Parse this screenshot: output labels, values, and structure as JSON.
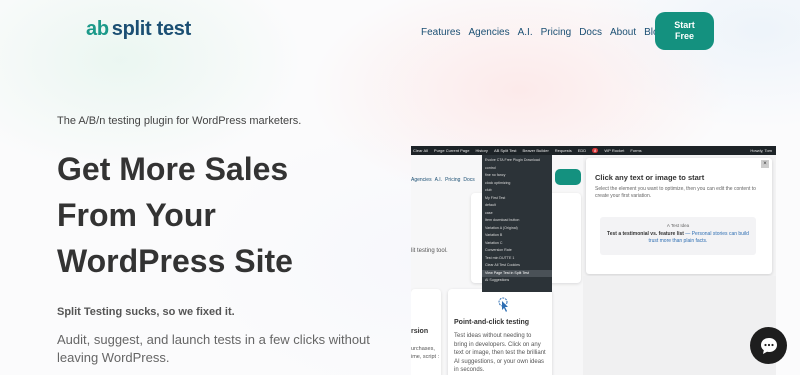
{
  "logo": {
    "ab": "ab",
    "text": "split test"
  },
  "nav": {
    "items": [
      "Features",
      "Agencies",
      "A.I.",
      "Pricing",
      "Docs",
      "About",
      "Blog"
    ]
  },
  "cta": {
    "label": "Start\nFree"
  },
  "hero": {
    "tagline": "The A/B/n testing plugin for WordPress marketers.",
    "headline": [
      "Get More Sales",
      "From Your",
      "WordPress Site"
    ],
    "subhead": "Split Testing sucks, so we fixed it.",
    "description": "Audit, suggest, and launch tests in a few clicks without leaving WordPress."
  },
  "screenshot": {
    "adminbar": [
      "Clear All",
      "Purge Current Page",
      "History",
      "AB Split Test",
      "Beaver Builder",
      "Requests",
      "EDD",
      "WP Rocket",
      "Forms"
    ],
    "adminbar_badge": "8",
    "adminbar_right": "Howdy, Tom",
    "site_nav": [
      "Agencies",
      "A.I.",
      "Pricing",
      "Docs"
    ],
    "site_card_text": "\"W me",
    "site_text": "lit testing tool.",
    "left_card": {
      "title": "rsion",
      "body": "urchases, ime, script :"
    },
    "feature_card": {
      "title": "Point-and-click testing",
      "body": "Test ideas without needing to bring in developers. Click on any text or image, then test the brilliant AI suggestions, or your own ideas in seconds."
    },
    "dropdown": [
      "Evolve CTA Free Plugin Download",
      "control",
      "fine no fancy",
      "clock optimizing",
      "club",
      "My First Test",
      "default",
      "case",
      "Item download button",
      "Variation A (Original)",
      "Variation B",
      "Variation C",
      "Conversion Rate",
      "Test min DUTTE 1",
      "Clear All Test Cookies",
      "View Page Test in Split Test",
      "AI Suggestions"
    ],
    "dropdown_highlight_index": 15,
    "panel": {
      "title": "Click any text or image to start",
      "text": "Select the element you want to optimize, then you can edit the content to create your first variation.",
      "close": "×",
      "idea_label": "A Test Idea",
      "idea_bold": "Test a testimonial vs. feature list",
      "idea_rest": " — Personal stories can build trust more than plain facts."
    }
  },
  "colors": {
    "brand_dark": "#1b4f73",
    "brand_teal": "#14917f",
    "text_dark": "#333333"
  },
  "icons": {
    "chat": "chat-bubble-icon",
    "pointer": "pointer-click-icon"
  }
}
